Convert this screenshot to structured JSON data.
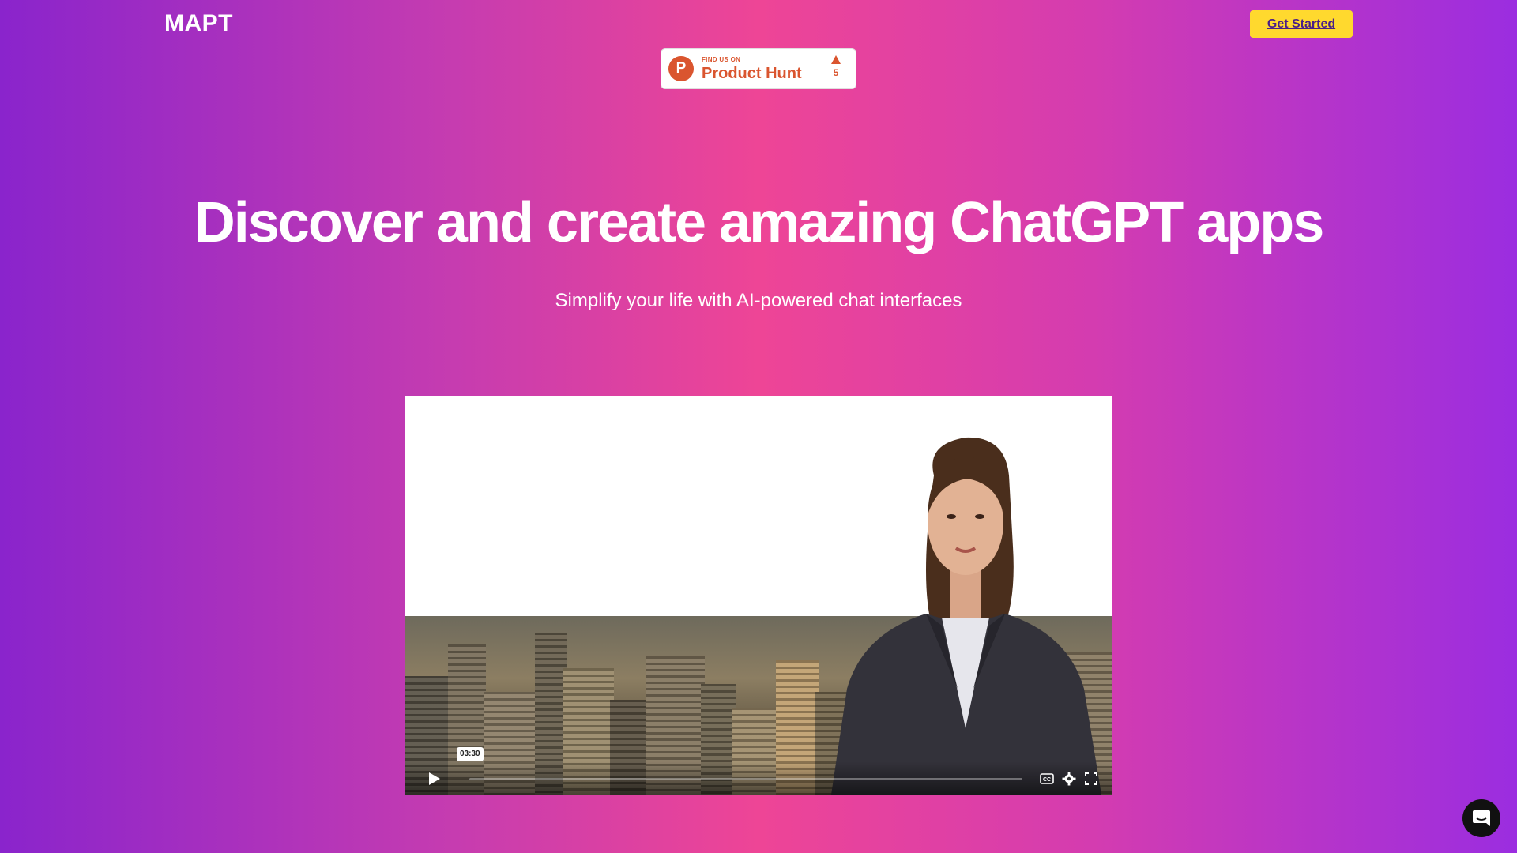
{
  "header": {
    "logo": "MAPT",
    "cta_label": "Get Started"
  },
  "product_hunt": {
    "small_label": "FIND US ON",
    "big_label": "Product Hunt",
    "logo_letter": "P",
    "upvotes": "5"
  },
  "hero": {
    "title": "Discover and create amazing ChatGPT apps",
    "subtitle": "Simplify your life with AI-powered chat interfaces"
  },
  "video": {
    "duration_tooltip": "03:30",
    "progress": 0,
    "icons": [
      "play-icon",
      "closed-captions-icon",
      "settings-gear-icon",
      "fullscreen-icon"
    ]
  },
  "chat": {
    "icon": "chat-bubble-icon"
  },
  "colors": {
    "cta_background": "#ffd92e",
    "product_hunt_orange": "#da552f",
    "gradient_pink": "#ee4596",
    "gradient_purple": "#8a24cc"
  }
}
